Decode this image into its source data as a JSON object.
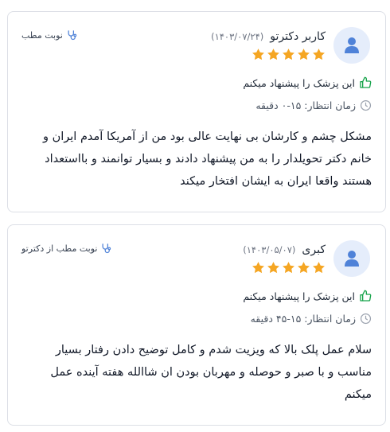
{
  "reviews": [
    {
      "author": "کاربر دکترتو",
      "date": "(۱۴۰۳/۰۷/۲۴)",
      "stars": 5,
      "booking_label": "نوبت مطب",
      "recommend_text": "این پزشک را پیشنهاد میکنم",
      "wait_text": "زمان انتظار: ۱۵-۰ دقیقه",
      "comment": "مشکل چشم و کارشان بی نهایت عالی بود من از آمریکا آمدم ایران و خانم دکتر تحویلدار را به من پیشنهاد دادند و بسیار توانمند و بااستعداد هستند واقعا ایران به ایشان افتخار میکند"
    },
    {
      "author": "کبری",
      "date": "(۱۴۰۳/۰۵/۰۷)",
      "stars": 5,
      "booking_label": "نوبت مطب از دکترتو",
      "recommend_text": "این پزشک را پیشنهاد میکنم",
      "wait_text": "زمان انتظار: ۱۵-۴۵ دقیقه",
      "comment": "سلام عمل پلک بالا که ویزیت شدم و کامل توضیح دادن رفتار بسیار مناسب و با صبر و حوصله و مهربان بودن ان شاالله هفته آینده عمل میکنم"
    }
  ],
  "colors": {
    "star": "#f5a623",
    "thumb": "#16a34a",
    "avatar_bg": "#e5edfb",
    "avatar_fg": "#4f82d8",
    "border": "#dcdfe6"
  },
  "icons": {
    "avatar": "user-icon",
    "booking": "stethoscope-icon",
    "recommend": "thumbs-up-icon",
    "wait": "clock-icon",
    "rating": "star-icon"
  }
}
